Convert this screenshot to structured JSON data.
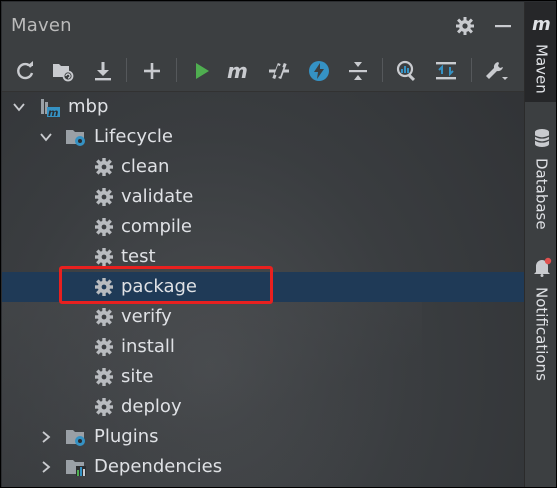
{
  "window": {
    "title": "Maven"
  },
  "toolbar": {
    "icons": [
      "reload-icon",
      "generate-sources-icon",
      "download-icon",
      "add-icon",
      "run-icon",
      "execute-goal-icon",
      "toggle-offline-icon",
      "skip-tests-icon",
      "collapse-all-icon",
      "analyze-dependencies-icon",
      "show-diagram-icon",
      "settings-wrench-icon"
    ]
  },
  "tree": {
    "project": "mbp",
    "lifecycle": "Lifecycle",
    "goals": [
      "clean",
      "validate",
      "compile",
      "test",
      "package",
      "verify",
      "install",
      "site",
      "deploy"
    ],
    "plugins": "Plugins",
    "dependencies": "Dependencies"
  },
  "stripe": {
    "maven": "Maven",
    "database": "Database",
    "notifications": "Notifications"
  },
  "colors": {
    "accent_green": "#4fae50",
    "accent_blue": "#3592c4",
    "highlight_red": "#e8201f",
    "selection": "#1f3a57"
  }
}
